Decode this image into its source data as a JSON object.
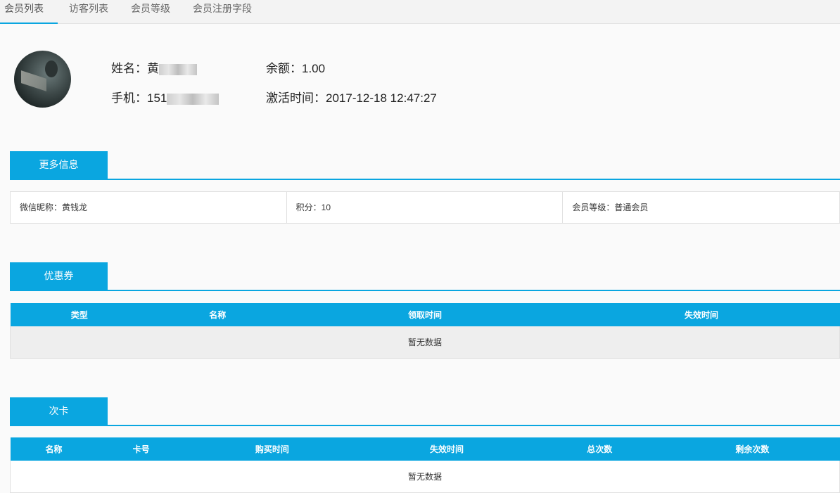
{
  "tabs": [
    {
      "label": "会员列表",
      "active": true
    },
    {
      "label": "访客列表",
      "active": false
    },
    {
      "label": "会员等级",
      "active": false
    },
    {
      "label": "会员注册字段",
      "active": false
    }
  ],
  "profile": {
    "name_label": "姓名：黄",
    "balance_label": "余额：1.00",
    "phone_label": "手机：151",
    "activated_label": "激活时间：2017-12-18 12:47:27"
  },
  "more_info": {
    "title": "更多信息",
    "wechat_nickname": "微信昵称：黄钱龙",
    "points": "积分：10",
    "member_level": "会员等级：普通会员"
  },
  "coupons": {
    "title": "优惠券",
    "columns": [
      "类型",
      "名称",
      "领取时间",
      "失效时间"
    ],
    "empty_text": "暂无数据"
  },
  "punch_cards": {
    "title": "次卡",
    "columns": [
      "名称",
      "卡号",
      "购买时间",
      "失效时间",
      "总次数",
      "剩余次数"
    ],
    "empty_text": "暂无数据"
  },
  "colors": {
    "accent": "#0aa6e0"
  },
  "icons": {
    "avatar": "user-avatar-photo"
  }
}
